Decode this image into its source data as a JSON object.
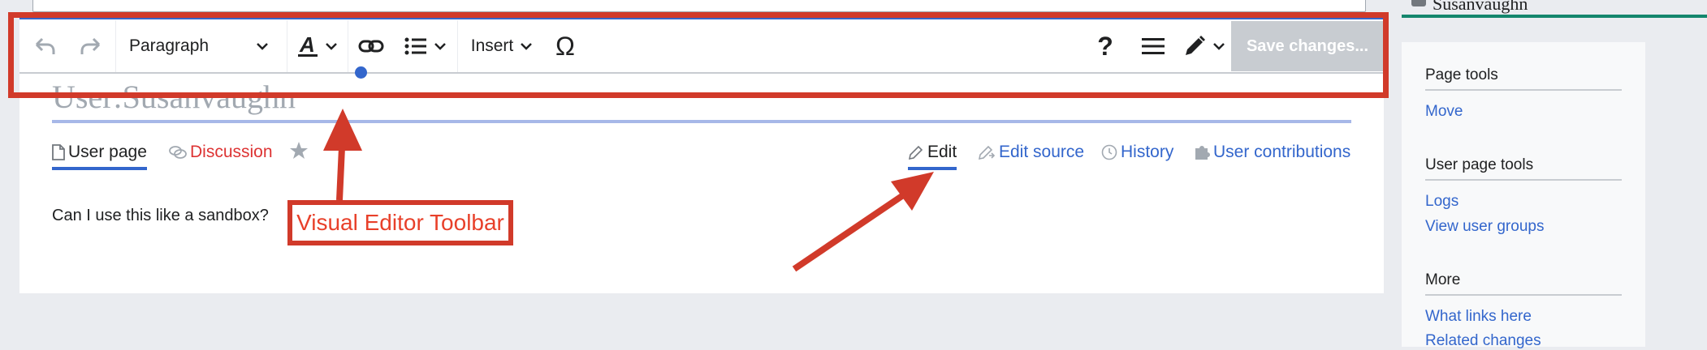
{
  "top": {
    "user_name": "Susanvaughn"
  },
  "toolbar": {
    "undo_icon": "undo-icon",
    "redo_icon": "redo-icon",
    "paragraph_label": "Paragraph",
    "insert_label": "Insert",
    "special_char": "Ω",
    "help": "?",
    "save_label": "Save changes..."
  },
  "page": {
    "title": "User:Susanvaughn",
    "body_text": "Can I use this like a sandbox?"
  },
  "tabs": {
    "user_page": "User page",
    "discussion": "Discussion",
    "edit": "Edit",
    "edit_source": "Edit source",
    "history": "History",
    "user_contributions": "User contributions"
  },
  "sidebar": {
    "page_tools": {
      "heading": "Page tools",
      "links": [
        "Move"
      ]
    },
    "user_page_tools": {
      "heading": "User page tools",
      "links": [
        "Logs",
        "View user groups"
      ]
    },
    "more": {
      "heading": "More",
      "links": [
        "What links here",
        "Related changes"
      ]
    }
  },
  "annotation": {
    "label": "Visual Editor Toolbar",
    "color": "#d13a2a"
  },
  "colors": {
    "link": "#3366cc",
    "red_link": "#dd3333",
    "accent": "#3366cc"
  }
}
